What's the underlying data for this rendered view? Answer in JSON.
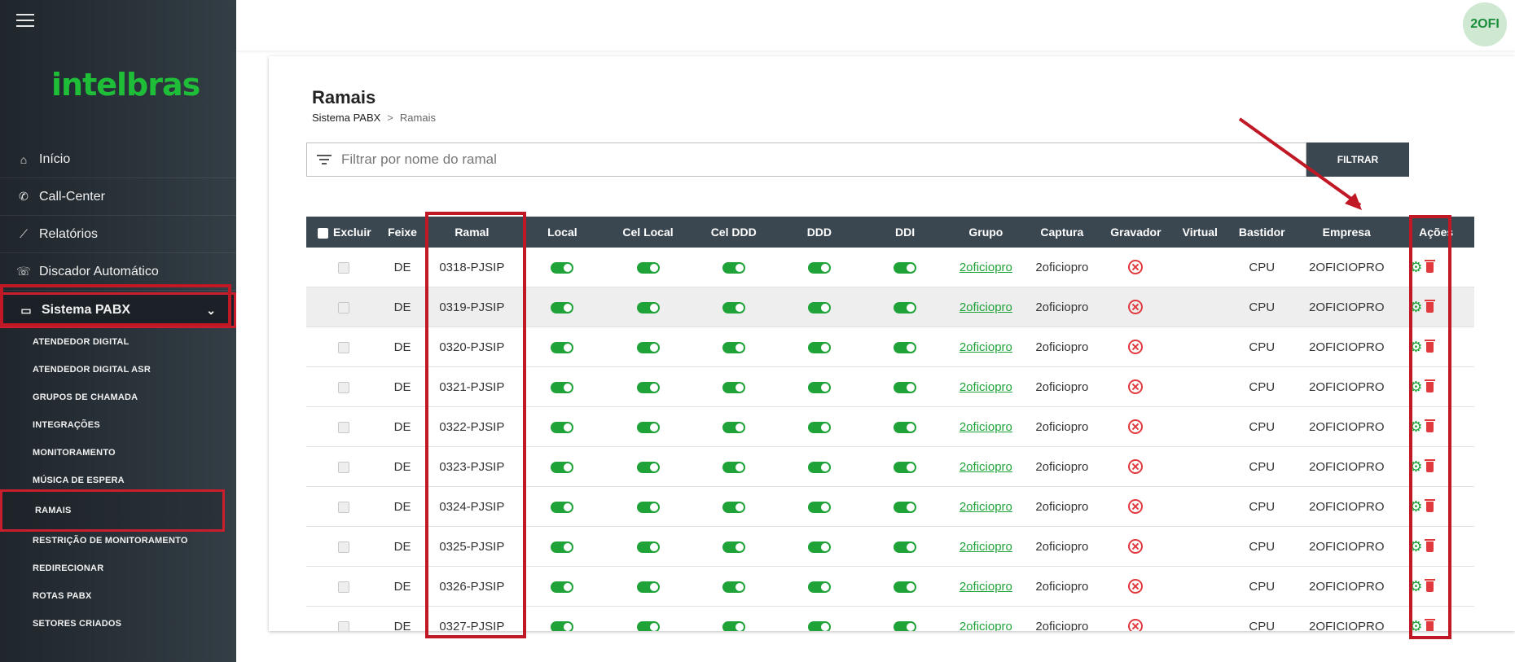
{
  "user": {
    "avatar_text": "2OFI"
  },
  "sidebar": {
    "logo": "intelbras",
    "nav": [
      {
        "label": "Início",
        "icon": "home-icon"
      },
      {
        "label": "Call-Center",
        "icon": "phone-icon"
      },
      {
        "label": "Relatórios",
        "icon": "chart-icon"
      },
      {
        "label": "Discador Automático",
        "icon": "dialer-icon"
      }
    ],
    "active_section": {
      "label": "Sistema PABX",
      "icon": "monitor-icon"
    },
    "submenu": [
      "ATENDEDOR DIGITAL",
      "ATENDEDOR DIGITAL ASR",
      "GRUPOS DE CHAMADA",
      "INTEGRAÇÕES",
      "MONITORAMENTO",
      "MÚSICA DE ESPERA",
      "RAMAIS",
      "RESTRIÇÃO DE MONITORAMENTO",
      "REDIRECIONAR",
      "ROTAS PABX",
      "SETORES CRIADOS"
    ],
    "active_submenu": "RAMAIS"
  },
  "page": {
    "title": "Ramais",
    "breadcrumb": {
      "parent": "Sistema PABX",
      "sep": ">",
      "current": "Ramais"
    },
    "filter": {
      "placeholder": "Filtrar por nome do ramal",
      "value": "",
      "button": "FILTRAR"
    }
  },
  "table": {
    "headers": [
      "Excluir",
      "Feixe",
      "Ramal",
      "Local",
      "Cel Local",
      "Cel DDD",
      "DDD",
      "DDI",
      "Grupo",
      "Captura",
      "Gravador",
      "Virtual",
      "Bastidor",
      "Empresa",
      "Ações"
    ],
    "rows": [
      {
        "feixe": "DE",
        "ramal": "0318-PJSIP",
        "grupo": "2oficiopro",
        "captura": "2oficiopro",
        "bastidor": "CPU",
        "empresa": "2OFICIOPRO"
      },
      {
        "feixe": "DE",
        "ramal": "0319-PJSIP",
        "grupo": "2oficiopro",
        "captura": "2oficiopro",
        "bastidor": "CPU",
        "empresa": "2OFICIOPRO"
      },
      {
        "feixe": "DE",
        "ramal": "0320-PJSIP",
        "grupo": "2oficiopro",
        "captura": "2oficiopro",
        "bastidor": "CPU",
        "empresa": "2OFICIOPRO"
      },
      {
        "feixe": "DE",
        "ramal": "0321-PJSIP",
        "grupo": "2oficiopro",
        "captura": "2oficiopro",
        "bastidor": "CPU",
        "empresa": "2OFICIOPRO"
      },
      {
        "feixe": "DE",
        "ramal": "0322-PJSIP",
        "grupo": "2oficiopro",
        "captura": "2oficiopro",
        "bastidor": "CPU",
        "empresa": "2OFICIOPRO"
      },
      {
        "feixe": "DE",
        "ramal": "0323-PJSIP",
        "grupo": "2oficiopro",
        "captura": "2oficiopro",
        "bastidor": "CPU",
        "empresa": "2OFICIOPRO"
      },
      {
        "feixe": "DE",
        "ramal": "0324-PJSIP",
        "grupo": "2oficiopro",
        "captura": "2oficiopro",
        "bastidor": "CPU",
        "empresa": "2OFICIOPRO"
      },
      {
        "feixe": "DE",
        "ramal": "0325-PJSIP",
        "grupo": "2oficiopro",
        "captura": "2oficiopro",
        "bastidor": "CPU",
        "empresa": "2OFICIOPRO"
      },
      {
        "feixe": "DE",
        "ramal": "0326-PJSIP",
        "grupo": "2oficiopro",
        "captura": "2oficiopro",
        "bastidor": "CPU",
        "empresa": "2OFICIOPRO"
      },
      {
        "feixe": "DE",
        "ramal": "0327-PJSIP",
        "grupo": "2oficiopro",
        "captura": "2oficiopro",
        "bastidor": "CPU",
        "empresa": "2OFICIOPRO"
      }
    ]
  },
  "colors": {
    "accent_green": "#1fa339",
    "header_bg": "#3a4650",
    "annotation_red": "#c01825",
    "danger": "#e0393e"
  }
}
